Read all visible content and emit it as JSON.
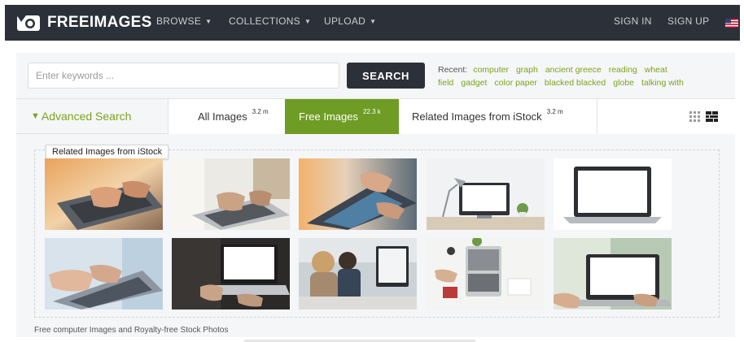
{
  "header": {
    "logo_text": "FREEIMAGES",
    "nav": {
      "browse": "BROWSE",
      "collections": "COLLECTIONS",
      "upload": "UPLOAD",
      "sign_in": "SIGN IN",
      "sign_up": "SIGN UP"
    }
  },
  "search": {
    "placeholder": "Enter keywords ...",
    "button_label": "SEARCH",
    "recent_label": "Recent:",
    "recent_tags": [
      "computer",
      "graph",
      "ancient greece",
      "reading",
      "wheat",
      "field",
      "gadget",
      "color paper",
      "blacked blacked",
      "globe",
      "talking with"
    ]
  },
  "filters": {
    "advanced_search": "Advanced Search",
    "tabs": [
      {
        "label": "All Images",
        "count": "3.2 m"
      },
      {
        "label": "Free Images",
        "count": "22.3 k"
      },
      {
        "label": "Related Images from iStock",
        "count": "3.2 m"
      }
    ]
  },
  "related": {
    "label": "Related Images from iStock",
    "thumbnails": [
      "hands-typing-laptop-warm-light",
      "hands-typing-laptop-window",
      "hands-laptop-pen-desk",
      "laptop-on-desk-with-lamp",
      "laptop-blank-screen-white",
      "hands-typing-laptop-blue",
      "person-holding-laptop-desk",
      "two-people-monitor-office",
      "top-view-desk-laptop",
      "hands-laptop-outdoor"
    ]
  },
  "footer": {
    "caption": "Free computer Images and Royalty-free Stock Photos"
  },
  "colors": {
    "nav_bg": "#2c3038",
    "accent_green": "#6e9c24",
    "tag_green": "#7ba31e"
  }
}
